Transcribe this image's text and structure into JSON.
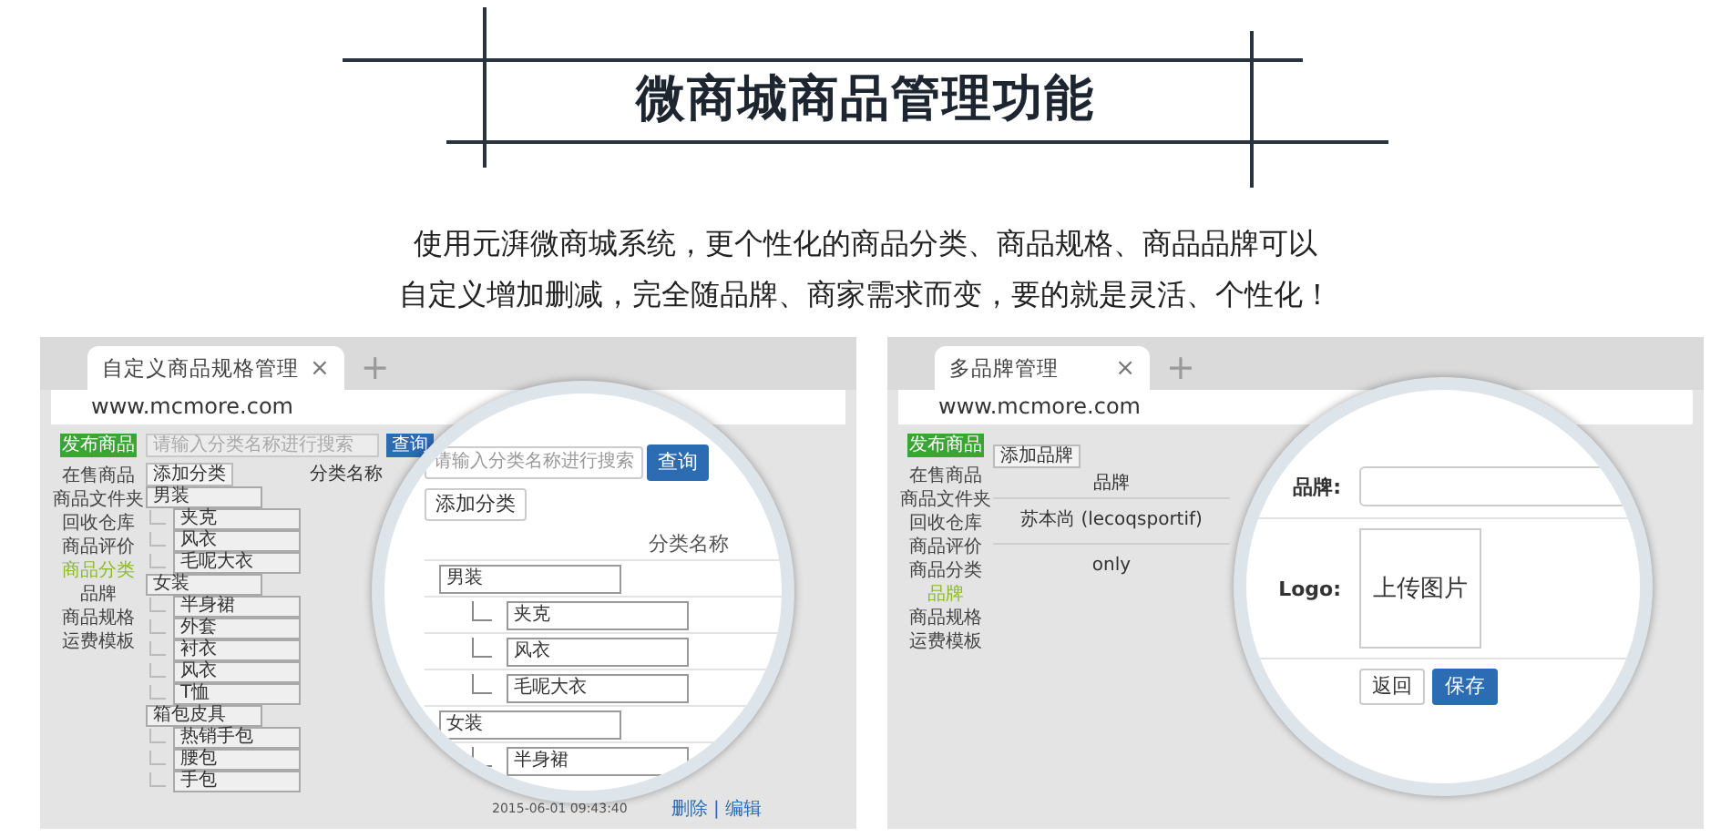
{
  "header": {
    "title": "微商城商品管理功能",
    "description": [
      "使用元湃微商城系统，更个性化的商品分类、商品规格、商品品牌可以",
      "自定义增加删减，完全随品牌、商家需求而变，要的就是灵活、个性化！"
    ]
  },
  "panels": [
    {
      "kind": "category",
      "tab": {
        "label": "自定义商品规格管理",
        "close": "×"
      },
      "new_tab": "+",
      "url": "www.mcmore.com",
      "publish_button": "发布商品",
      "sidebar": [
        {
          "label": "在售商品",
          "selected": false
        },
        {
          "label": "商品文件夹",
          "selected": false
        },
        {
          "label": "回收仓库",
          "selected": false
        },
        {
          "label": "商品评价",
          "selected": false
        },
        {
          "label": "商品分类",
          "selected": true
        },
        {
          "label": "品牌",
          "selected": false
        },
        {
          "label": "商品规格",
          "selected": false
        },
        {
          "label": "运费模板",
          "selected": false
        }
      ],
      "search": {
        "placeholder": "请输入分类名称进行搜索"
      },
      "search_button": "查询",
      "add_button": "添加分类",
      "column": "分类名称",
      "tree": [
        {
          "name": "男装",
          "children": [
            {
              "name": "夹克"
            },
            {
              "name": "风衣"
            },
            {
              "name": "毛呢大衣"
            }
          ]
        },
        {
          "name": "女装",
          "children": [
            {
              "name": "半身裙"
            },
            {
              "name": "外套"
            },
            {
              "name": "衬衣"
            },
            {
              "name": "风衣"
            },
            {
              "name": "T恤"
            }
          ]
        },
        {
          "name": "箱包皮具",
          "children": [
            {
              "name": "热销手包"
            },
            {
              "name": "腰包"
            },
            {
              "name": "手包"
            }
          ]
        }
      ],
      "last_row": {
        "time": "2015-06-01 09:43:40",
        "actions": "删除 | 编辑"
      },
      "lens": {
        "search": {
          "placeholder": "请输入分类名称进行搜索"
        },
        "search_button": "查询",
        "add_button": "添加分类",
        "column": "分类名称",
        "tree": [
          {
            "name": "男装",
            "children": [
              {
                "name": "夹克"
              },
              {
                "name": "风衣"
              },
              {
                "name": "毛呢大衣"
              }
            ]
          },
          {
            "name": "女装",
            "children": [
              {
                "name": "半身裙"
              }
            ]
          }
        ]
      }
    },
    {
      "kind": "brand",
      "tab": {
        "label": "多品牌管理",
        "close": "×"
      },
      "new_tab": "+",
      "url": "www.mcmore.com",
      "publish_button": "发布商品",
      "sidebar": [
        {
          "label": "在售商品",
          "selected": false
        },
        {
          "label": "商品文件夹",
          "selected": false
        },
        {
          "label": "回收仓库",
          "selected": false
        },
        {
          "label": "商品评价",
          "selected": false
        },
        {
          "label": "商品分类",
          "selected": false
        },
        {
          "label": "品牌",
          "selected": true
        },
        {
          "label": "商品规格",
          "selected": false
        },
        {
          "label": "运费模板",
          "selected": false
        }
      ],
      "add_button": "添加品牌",
      "column": "品牌",
      "rows": [
        "苏本尚 (lecoqsportif)",
        "only"
      ],
      "lens": {
        "brand_label": "品牌:",
        "logo_label": "Logo:",
        "upload": "上传图片",
        "back_button": "返回",
        "save_button": "保存"
      }
    }
  ]
}
